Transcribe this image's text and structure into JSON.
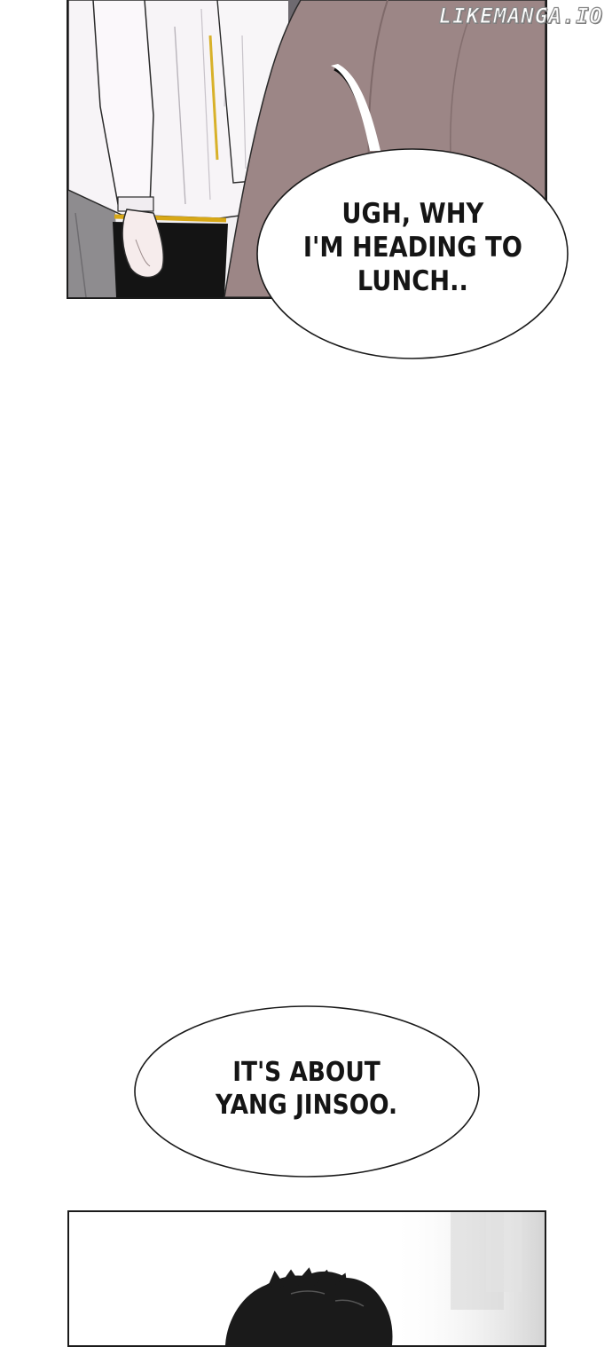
{
  "watermark": {
    "text": "LIKEMANGA.IO"
  },
  "bubbles": [
    {
      "text": "UGH, WHY\nI'M HEADING TO\nLUNCH.."
    },
    {
      "text": "IT'S ABOUT\nYANG JINSOO."
    }
  ]
}
